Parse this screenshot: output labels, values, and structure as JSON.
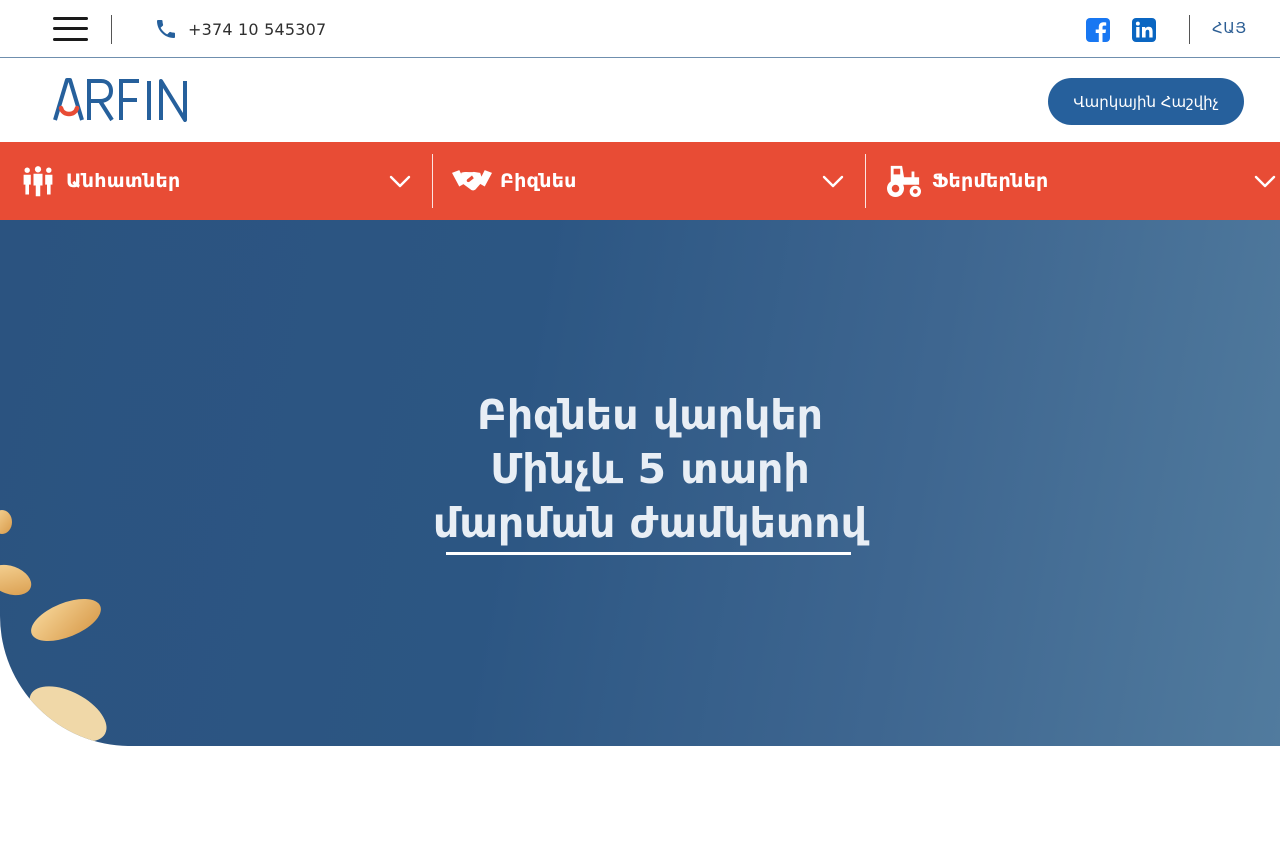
{
  "topbar": {
    "phone": "+374 10 545307",
    "language": "ՀԱՅ"
  },
  "header": {
    "logo_text": "ARFIN",
    "calculator_button": "Վարկային Հաշվիչ"
  },
  "nav": {
    "items": [
      {
        "label": "Անհատներ",
        "icon": "people-icon"
      },
      {
        "label": "Բիզնես",
        "icon": "handshake-icon"
      },
      {
        "label": "Ֆերմերներ",
        "icon": "tractor-icon"
      }
    ]
  },
  "hero": {
    "line1": "Բիզնես վարկեր",
    "line2": "Մինչև 5 տարի",
    "line3": "մարման ժամկետով"
  },
  "colors": {
    "nav_bg": "#e84c35",
    "brand_blue": "#26609c",
    "logo_red": "#e84c35",
    "hero_start": "#2b5380",
    "hero_end": "#517b9e"
  }
}
